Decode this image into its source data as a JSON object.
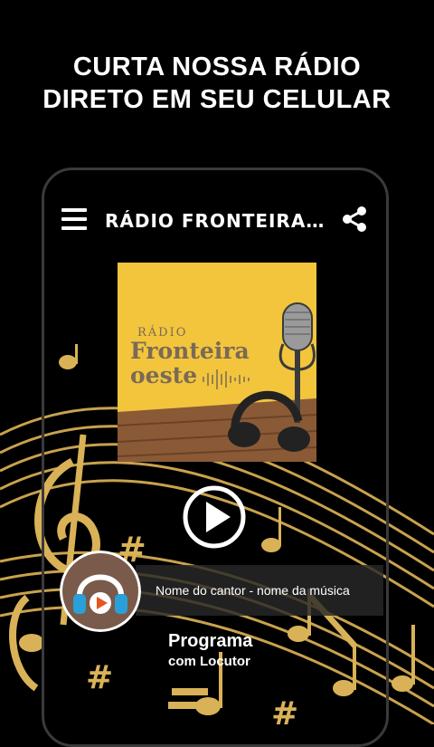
{
  "headline": {
    "line1": "CURTA NOSSA RÁDIO",
    "line2": "DIRETO EM SEU CELULAR"
  },
  "appbar": {
    "title": "RÁDIO FRONTEIRA OE...",
    "menu_icon": "menu-icon",
    "share_icon": "share-icon"
  },
  "cover": {
    "radio_label": "RÁDIO",
    "name_line1": "Fronteira",
    "name_line2": "oeste"
  },
  "player": {
    "play_icon": "play-icon",
    "now_playing": "Nome do cantor - nome da música",
    "program": "Programa",
    "host": "com Locutor"
  },
  "colors": {
    "gold": "#d9b257",
    "cover_yellow": "#f2c53d",
    "logo_brown": "#7a5a4a",
    "accent_orange": "#e8541c",
    "accent_blue": "#2aa0d8"
  }
}
